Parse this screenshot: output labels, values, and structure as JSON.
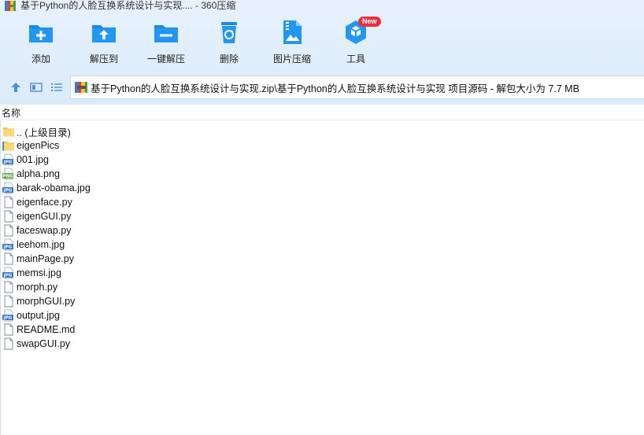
{
  "window": {
    "title": "基于Python的人脸互换系统设计与实现.... - 360压缩"
  },
  "toolbar": {
    "add": "添加",
    "extract_to": "解压到",
    "one_click_extract": "一键解压",
    "delete": "删除",
    "image_compress": "图片压缩",
    "tools": "工具",
    "tools_badge": "New"
  },
  "address": {
    "path": "基于Python的人脸互换系统设计与实现.zip\\基于Python的人脸互换系统设计与实现 项目源码 - 解包大小为 7.7 MB"
  },
  "list": {
    "column_name": "名称",
    "items": [
      {
        "name": ".. (上级目录)",
        "type": "folder-up"
      },
      {
        "name": "eigenPics",
        "type": "folder"
      },
      {
        "name": "001.jpg",
        "type": "jpg"
      },
      {
        "name": "alpha.png",
        "type": "png"
      },
      {
        "name": "barak-obama.jpg",
        "type": "jpg"
      },
      {
        "name": "eigenface.py",
        "type": "file"
      },
      {
        "name": "eigenGUI.py",
        "type": "file"
      },
      {
        "name": "faceswap.py",
        "type": "file"
      },
      {
        "name": "leehom.jpg",
        "type": "jpg"
      },
      {
        "name": "mainPage.py",
        "type": "file"
      },
      {
        "name": "memsi.jpg",
        "type": "jpg"
      },
      {
        "name": "morph.py",
        "type": "file"
      },
      {
        "name": "morphGUI.py",
        "type": "file"
      },
      {
        "name": "output.jpg",
        "type": "jpg"
      },
      {
        "name": "README.md",
        "type": "file"
      },
      {
        "name": "swapGUI.py",
        "type": "file"
      }
    ]
  }
}
